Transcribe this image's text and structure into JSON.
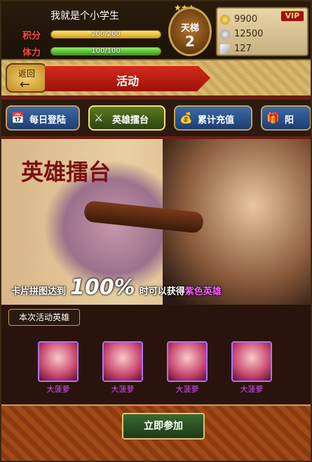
{
  "player": {
    "name": "我就是个小学生",
    "score_label": "积分",
    "score_value": "200/200",
    "score_fraction": 1.0,
    "stamina_label": "体力",
    "stamina_value": "100/100",
    "stamina_fraction": 1.0
  },
  "ladder": {
    "label": "天梯",
    "number": "2"
  },
  "resources": {
    "vip": "VIP",
    "gold": "9900",
    "silver": "12500",
    "feather": "127"
  },
  "header": {
    "back_label": "返回",
    "title": "活动"
  },
  "tabs": [
    {
      "label": "每日登陆",
      "icon": "calendar-icon"
    },
    {
      "label": "英雄擂台",
      "icon": "crossed-swords-icon",
      "active": true
    },
    {
      "label": "累计充值",
      "icon": "ingot-icon"
    },
    {
      "label": "阳",
      "icon": "gift-icon"
    }
  ],
  "banner": {
    "title": "英雄擂台",
    "desc_prefix": "卡片拼图达到",
    "desc_percent": "100%",
    "desc_mid": "时可以获得",
    "desc_highlight": "紫色英雄"
  },
  "heroes": {
    "section_title": "本次活动英雄",
    "cards": [
      {
        "name": "大菠萝"
      },
      {
        "name": "大菠萝"
      },
      {
        "name": "大菠萝"
      },
      {
        "name": "大菠萝"
      }
    ]
  },
  "action": {
    "join_label": "立即参加"
  },
  "colors": {
    "accent_red": "#d62a1c",
    "gold_border": "#c8a050",
    "purple_text": "#d050ff"
  }
}
